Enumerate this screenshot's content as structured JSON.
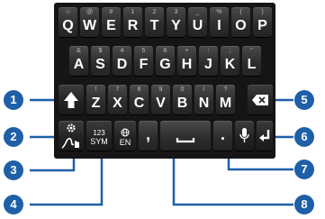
{
  "rows": [
    [
      {
        "sec": "☺",
        "pri": "Q"
      },
      {
        "sec": "@",
        "pri": "W"
      },
      {
        "sec": "#",
        "pri": "E"
      },
      {
        "sec": "1",
        "pri": "R"
      },
      {
        "sec": "2",
        "pri": "T"
      },
      {
        "sec": "3",
        "pri": "Y"
      },
      {
        "sec": "_",
        "pri": "U"
      },
      {
        "sec": "%",
        "pri": "I"
      },
      {
        "sec": "(",
        "pri": "O"
      },
      {
        "sec": ")",
        "pri": "P"
      }
    ],
    [
      {
        "sec": "&",
        "pri": "A"
      },
      {
        "sec": "$",
        "pri": "S"
      },
      {
        "sec": "4",
        "pri": "D"
      },
      {
        "sec": "5",
        "pri": "F"
      },
      {
        "sec": "6",
        "pri": "G"
      },
      {
        "sec": "+",
        "pri": "H"
      },
      {
        "sec": ":",
        "pri": "J"
      },
      {
        "sec": ";",
        "pri": "K"
      },
      {
        "sec": "\"",
        "pri": "L"
      }
    ],
    [
      {
        "sec": "!",
        "pri": "Z"
      },
      {
        "sec": "7",
        "pri": "X"
      },
      {
        "sec": "8",
        "pri": "C"
      },
      {
        "sec": "9",
        "pri": "V"
      },
      {
        "sec": "0",
        "pri": "B"
      },
      {
        "sec": "/",
        "pri": "N"
      },
      {
        "sec": "?",
        "pri": "M"
      }
    ]
  ],
  "bottom": {
    "sym_top": "123",
    "sym_bottom": "SYM",
    "lang": "EN",
    "comma": ",",
    "period": "."
  },
  "icons": {
    "shift": "shift-arrow-icon",
    "settings": "gear-icon",
    "handwriting": "handwriting-icon",
    "globe": "globe-icon",
    "space": "space-bar-icon",
    "mic": "microphone-icon",
    "backspace": "backspace-icon",
    "enter": "enter-arrow-icon"
  },
  "callouts": [
    "1",
    "2",
    "3",
    "4",
    "5",
    "6",
    "7",
    "8"
  ],
  "colors": {
    "callout": "#1e5fa8",
    "keyboard": "#151515"
  }
}
